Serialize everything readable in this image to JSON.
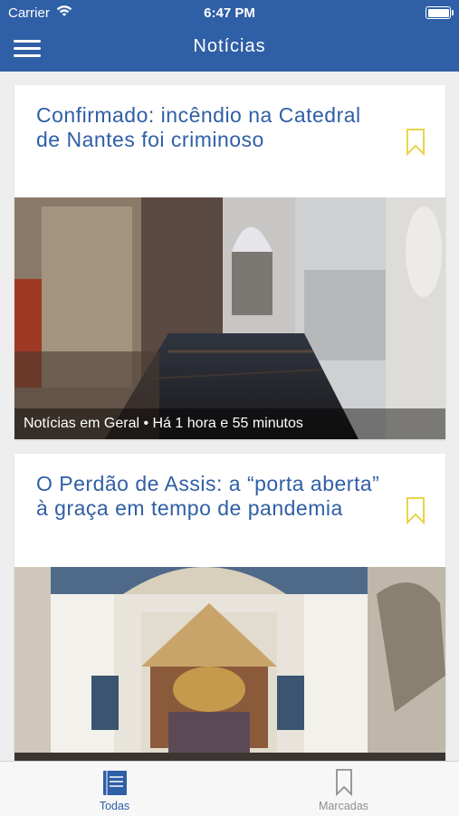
{
  "status_bar": {
    "carrier": "Carrier",
    "time": "6:47 PM"
  },
  "header": {
    "title": "Notícias"
  },
  "articles": [
    {
      "title": "Confirmado: incêndio na Catedral de Nantes foi criminoso",
      "meta": "Notícias em Geral • Há 1 hora e 55 minutos",
      "bookmark_icon": "bookmark-outline-icon"
    },
    {
      "title": "O Perdão de Assis: a “porta aberta” à graça em tempo de pandemia",
      "meta": "",
      "bookmark_icon": "bookmark-outline-icon"
    }
  ],
  "tabbar": {
    "tabs": [
      {
        "label": "Todas",
        "icon": "book-icon",
        "active": true
      },
      {
        "label": "Marcadas",
        "icon": "bookmark-outline-icon",
        "active": false
      }
    ]
  },
  "colors": {
    "brand": "#2f5fa6",
    "bookmark": "#e9d34a",
    "background": "#eeeeee"
  }
}
